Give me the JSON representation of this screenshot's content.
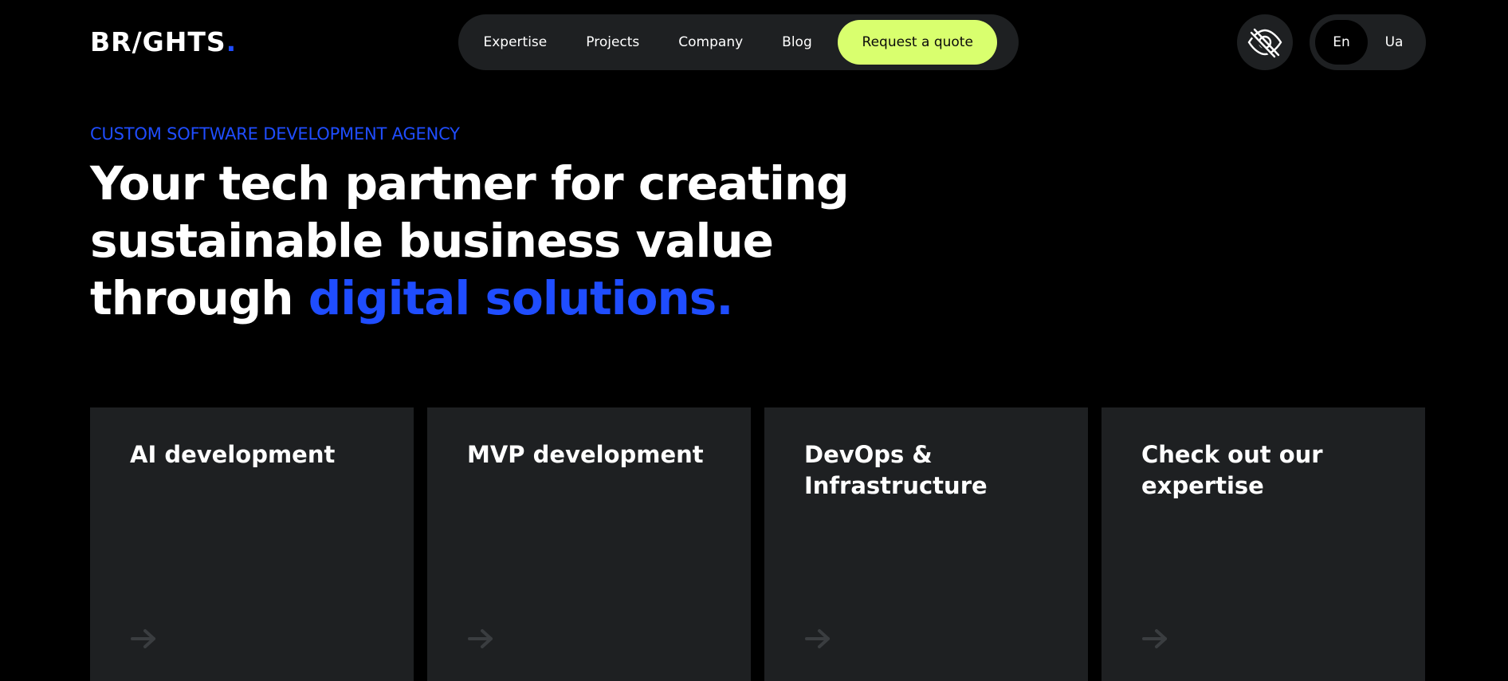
{
  "header": {
    "logo_text": "BR/GHTS",
    "logo_dot": ".",
    "nav": [
      {
        "label": "Expertise"
      },
      {
        "label": "Projects"
      },
      {
        "label": "Company"
      },
      {
        "label": "Blog"
      }
    ],
    "cta_label": "Request a quote",
    "cta_color": "#d9ff6e",
    "accessibility_icon": "eye-slash-icon",
    "languages": [
      {
        "label": "En",
        "active": true
      },
      {
        "label": "Ua",
        "active": false
      }
    ]
  },
  "hero": {
    "eyebrow": "CUSTOM SOFTWARE DEVELOPMENT AGENCY",
    "headline_line1": "Your tech partner for creating",
    "headline_line2": "sustainable business value",
    "headline_line3_prefix": "through ",
    "headline_accent": "digital solutions",
    "headline_accent_dot": "."
  },
  "cards": [
    {
      "title": "AI development",
      "arrow_icon": "arrow-right-icon"
    },
    {
      "title": "MVP development",
      "arrow_icon": "arrow-right-icon"
    },
    {
      "title": "DevOps & Infrastructure",
      "arrow_icon": "arrow-right-icon"
    },
    {
      "title": "Check out our expertise",
      "arrow_icon": "arrow-right-icon"
    }
  ],
  "colors": {
    "background": "#000000",
    "surface": "#1e2022",
    "accent_blue": "#1f4dff",
    "accent_lime": "#d9ff6e",
    "text": "#ffffff",
    "arrow_muted": "#3a3d40"
  }
}
